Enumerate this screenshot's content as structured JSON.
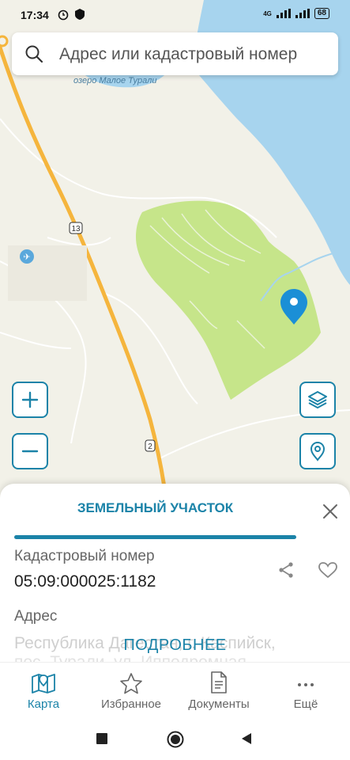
{
  "status_bar": {
    "time": "17:34",
    "network": "4G",
    "battery": "68"
  },
  "search": {
    "placeholder": "Адрес или кадастровый номер"
  },
  "map": {
    "lake_label": "озеро Малое Турали",
    "road_badges": [
      "13",
      "2"
    ],
    "colors": {
      "water": "#a7d4ee",
      "land": "#f2f1e8",
      "parcel": "#c6e58a",
      "road": "#f5b53d",
      "pin": "#1b8fd6"
    }
  },
  "map_controls": {
    "zoom_in_icon": "plus-icon",
    "zoom_out_icon": "minus-icon",
    "layers_icon": "layers-icon",
    "location_icon": "location-pin-icon"
  },
  "sheet": {
    "title": "ЗЕМЕЛЬНЫЙ УЧАСТОК",
    "cadastral_label": "Кадастровый номер",
    "cadastral_value": "05:09:000025:1182",
    "address_label": "Адрес",
    "address_value": "Республика Дагестан, г. Каспийск,",
    "address_value_2": "пос. Турали, ул. Ипподромная",
    "more_button": "ПОДРОБНЕЕ"
  },
  "tabs": [
    {
      "label": "Карта",
      "icon": "map-icon",
      "active": true
    },
    {
      "label": "Избранное",
      "icon": "star-icon",
      "active": false
    },
    {
      "label": "Документы",
      "icon": "document-icon",
      "active": false
    },
    {
      "label": "Ещё",
      "icon": "more-icon",
      "active": false
    }
  ],
  "accent_color": "#1b83a8"
}
